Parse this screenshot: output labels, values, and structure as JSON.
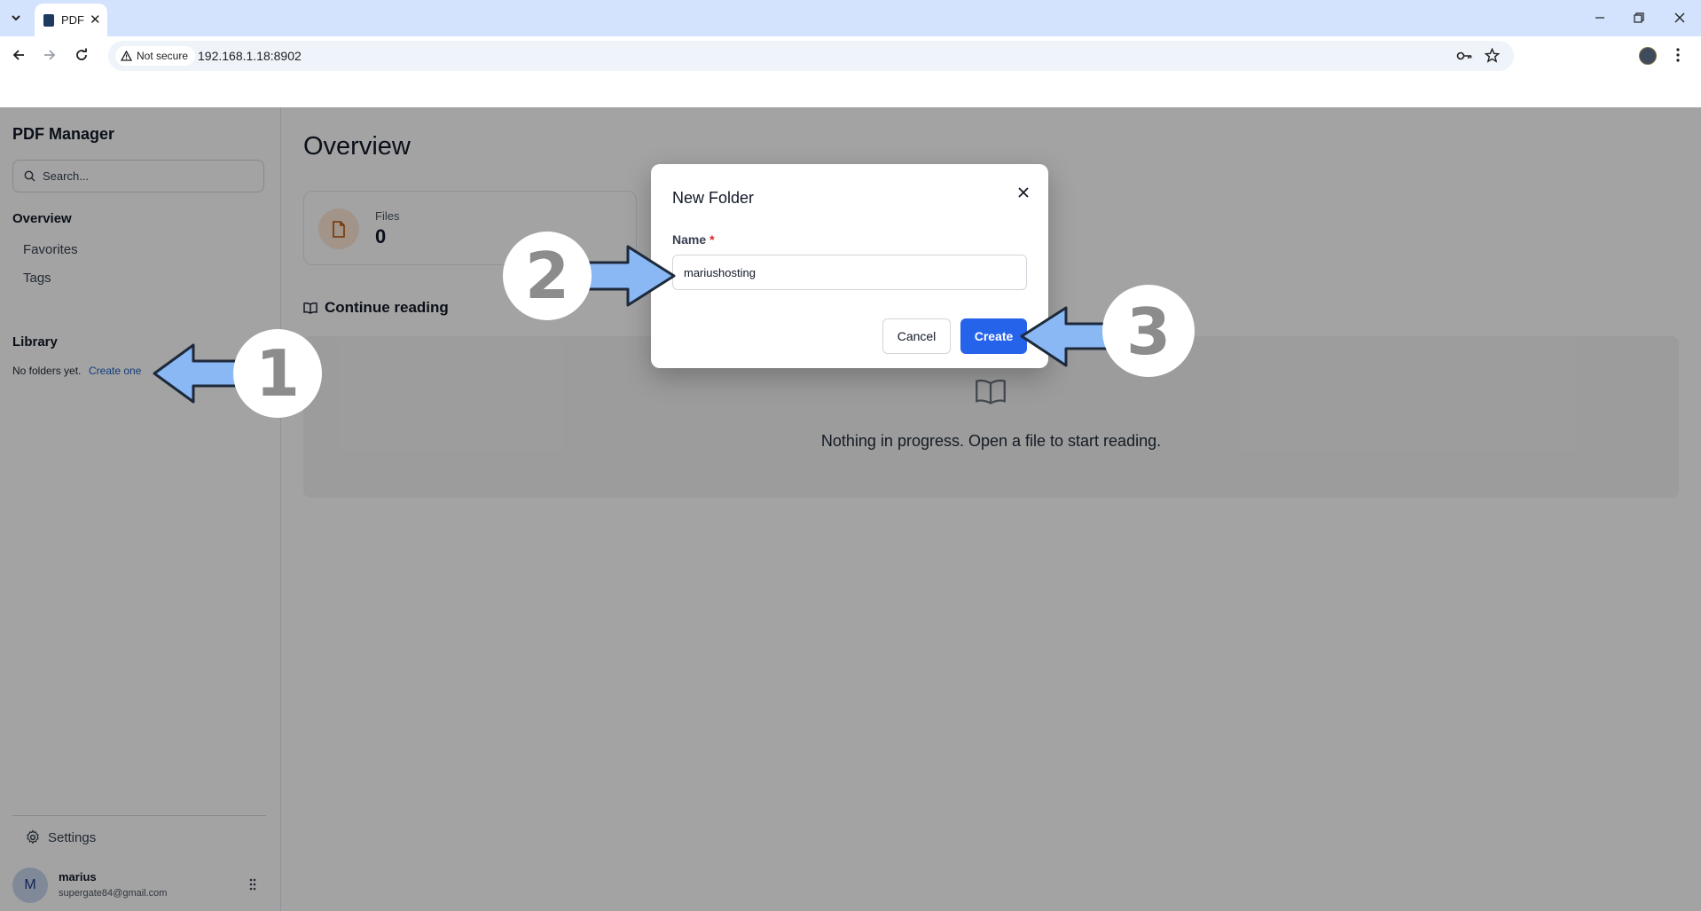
{
  "browser": {
    "tab_title": "PDF",
    "not_secure_label": "Not secure",
    "url": "192.168.1.18:8902"
  },
  "sidebar": {
    "app_title": "PDF Manager",
    "search_placeholder": "Search...",
    "nav": {
      "overview": "Overview",
      "favorites": "Favorites",
      "tags": "Tags"
    },
    "library": {
      "heading": "Library",
      "empty_text": "No folders yet.",
      "create_link": "Create one"
    },
    "settings_label": "Settings",
    "user": {
      "initial": "M",
      "name": "marius",
      "email": "supergate84@gmail.com"
    }
  },
  "main": {
    "title": "Overview",
    "files_card": {
      "label": "Files",
      "value": "0"
    },
    "continue_reading": "Continue reading",
    "empty_message": "Nothing in progress. Open a file to start reading."
  },
  "modal": {
    "title": "New Folder",
    "name_label": "Name",
    "required_marker": "*",
    "name_value": "mariushosting",
    "cancel_label": "Cancel",
    "create_label": "Create"
  },
  "annotations": {
    "step1": "1",
    "step2": "2",
    "step3": "3"
  },
  "colors": {
    "accent": "#2563eb",
    "annotation_arrow": "#8ab8f5",
    "tabbar": "#d3e3fd"
  }
}
